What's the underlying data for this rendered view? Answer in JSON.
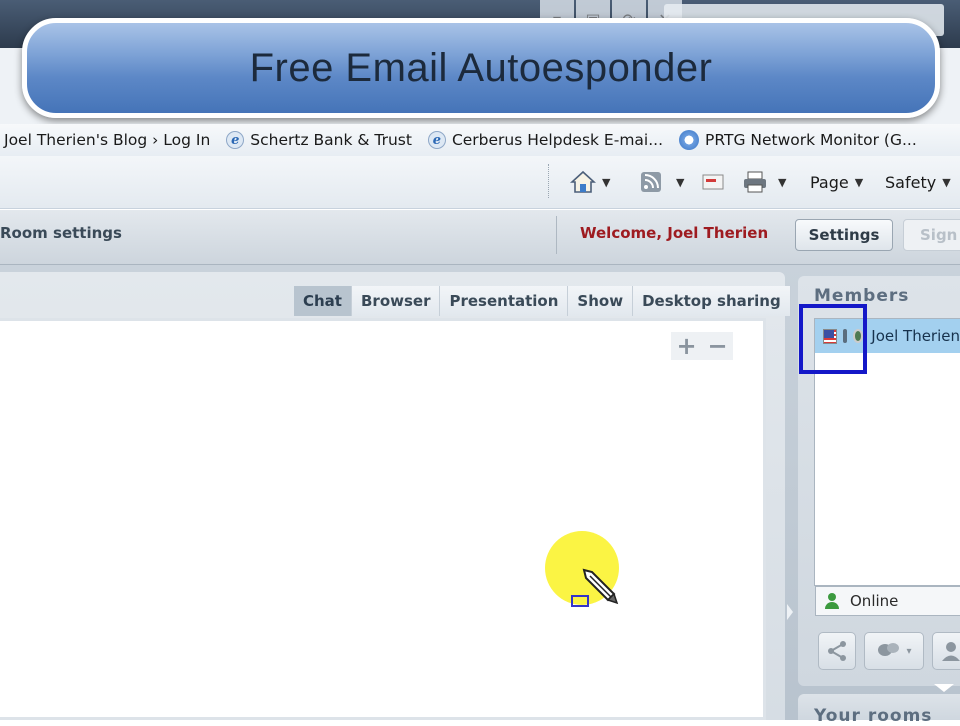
{
  "overlay": {
    "title": "Free Email Autoesponder"
  },
  "favorites": [
    {
      "label": "Joel Therien's Blog › Log In",
      "icon": "none"
    },
    {
      "label": "Schertz Bank & Trust",
      "icon": "ie-icon"
    },
    {
      "label": "Cerberus Helpdesk  E-mai...",
      "icon": "ie-icon"
    },
    {
      "label": "PRTG Network Monitor (G...",
      "icon": "prtg-icon"
    }
  ],
  "command_bar": {
    "home_icon": "home-icon",
    "feeds_icon": "rss-icon",
    "mail_icon": "mail-icon",
    "print_icon": "printer-icon",
    "page_label": "Page",
    "safety_label": "Safety"
  },
  "header": {
    "room_settings": "Room settings",
    "welcome": "Welcome, Joel Therien",
    "settings_button": "Settings",
    "signout_button": "Sign"
  },
  "tabs": [
    {
      "label": "Chat",
      "active": true
    },
    {
      "label": "Browser",
      "active": false
    },
    {
      "label": "Presentation",
      "active": false
    },
    {
      "label": "Show",
      "active": false
    },
    {
      "label": "Desktop sharing",
      "active": false
    }
  ],
  "zoom": {
    "plus": "+",
    "minus": "−"
  },
  "members": {
    "heading": "Members",
    "list": [
      {
        "name": "Joel Therien",
        "flag": "us-flag-icon"
      }
    ],
    "status": "Online"
  },
  "your_rooms": {
    "heading": "Your rooms"
  },
  "colors": {
    "welcome_text": "#9e1b20",
    "member_row": "#a3d0ef",
    "highlight_box": "#1418c8",
    "cursor_highlight": "#fbf334"
  }
}
